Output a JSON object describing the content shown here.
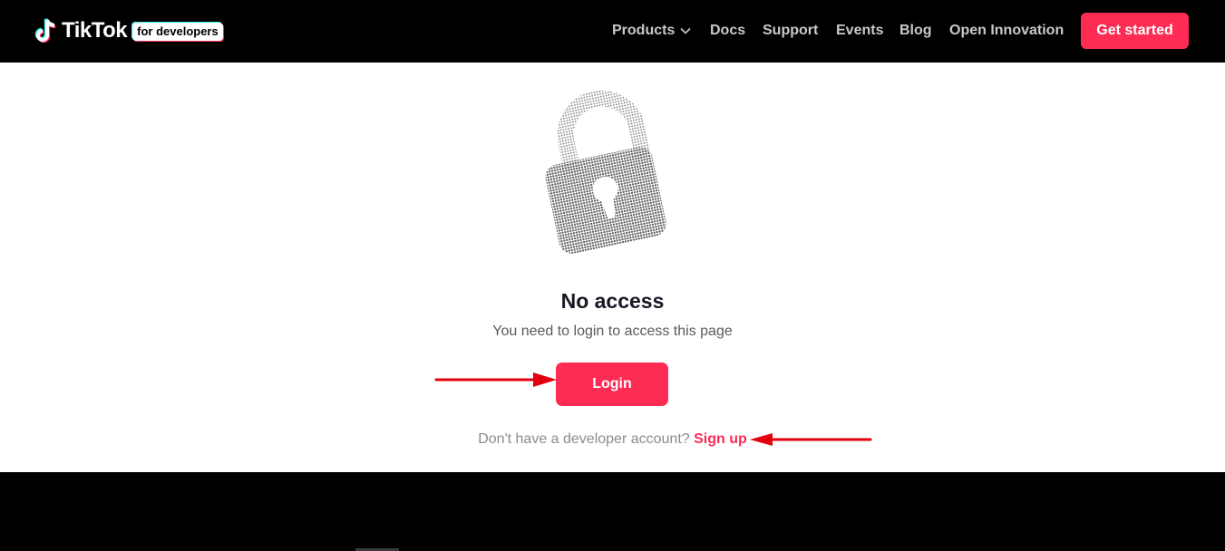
{
  "header": {
    "logo_text": "TikTok",
    "logo_badge": "for developers",
    "nav": [
      {
        "label": "Products"
      },
      {
        "label": "Docs"
      },
      {
        "label": "Support"
      },
      {
        "label": "Events"
      },
      {
        "label": "Blog"
      },
      {
        "label": "Open Innovation"
      }
    ],
    "cta_label": "Get started"
  },
  "main": {
    "icon": "lock-icon",
    "title": "No access",
    "subtitle": "You need to login to access this page",
    "login_label": "Login",
    "signup_prompt": "Don't have a developer account?",
    "signup_label": "Sign up"
  },
  "colors": {
    "brand_pink": "#fe2c55",
    "brand_cyan": "#25f4ee",
    "header_bg": "#000000",
    "annotation_arrow": "#e3000f"
  }
}
